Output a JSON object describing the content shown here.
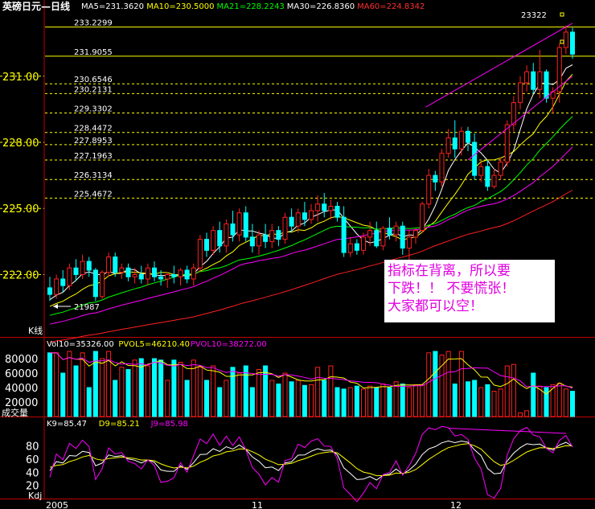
{
  "title": "英磅日元—日线",
  "ma_legend": [
    {
      "label": "MA5=231.3620",
      "color": "#ffffff"
    },
    {
      "label": "MA10=230.5000",
      "color": "#ffff00"
    },
    {
      "label": "MA21=228.2243",
      "color": "#00ff00"
    },
    {
      "label": "MA30=226.8360",
      "color": "#ffffff"
    },
    {
      "label": "MA60=224.8342",
      "color": "#ff3030"
    }
  ],
  "price_axis_ticks": [
    "231.00",
    "228.00",
    "225.00",
    "222.00"
  ],
  "fib_levels": [
    "233.2299",
    "231.9055",
    "230.6546",
    "230.2131",
    "229.3302",
    "228.4472",
    "227.8953",
    "227.1963",
    "226.3134",
    "225.4672"
  ],
  "high_label": "23322",
  "low_label": "21987",
  "kline_label": "K线",
  "annotation": [
    "指标在背离，所以要",
    "下跌！！ 不要慌张！",
    "大家都可以空！"
  ],
  "volume": {
    "legend": [
      {
        "label": "Vol10=35326.00",
        "color": "#ffffff"
      },
      {
        "label": "PVOL5=46210.40",
        "color": "#ffff00"
      },
      {
        "label": "PVOL10=38272.00",
        "color": "#ff00ff"
      }
    ],
    "axis_ticks": [
      "80000",
      "60000",
      "40000",
      "20000"
    ],
    "panel_label": "成交量"
  },
  "kdj": {
    "legend": [
      {
        "label": "K9=85.47",
        "color": "#ffffff"
      },
      {
        "label": "D9=85.21",
        "color": "#ffff00"
      },
      {
        "label": "J9=85.98",
        "color": "#ff00ff"
      }
    ],
    "axis_ticks": [
      "80",
      "60",
      "40",
      "20"
    ],
    "panel_label": "Kdj"
  },
  "date_axis": [
    "2005",
    "11",
    "12"
  ],
  "chart_data": {
    "type": "candlestick",
    "title": "英磅日元—日线",
    "price_range": [
      219.5,
      233.8
    ],
    "candles_ohlc": [
      [
        221.4,
        221.9,
        220.8,
        221.1
      ],
      [
        221.1,
        222.0,
        220.9,
        221.8
      ],
      [
        221.8,
        222.2,
        221.2,
        221.5
      ],
      [
        221.5,
        222.5,
        221.3,
        222.3
      ],
      [
        222.3,
        222.7,
        221.7,
        222.0
      ],
      [
        222.0,
        222.9,
        221.8,
        222.6
      ],
      [
        222.6,
        222.8,
        221.9,
        222.2
      ],
      [
        222.2,
        222.3,
        220.8,
        221.0
      ],
      [
        221.0,
        222.2,
        220.9,
        222.1
      ],
      [
        222.1,
        223.0,
        221.9,
        222.8
      ],
      [
        222.8,
        223.0,
        221.9,
        222.1
      ],
      [
        222.1,
        222.5,
        221.8,
        222.3
      ],
      [
        222.3,
        222.5,
        221.7,
        221.9
      ],
      [
        221.9,
        222.3,
        221.6,
        222.0
      ],
      [
        222.0,
        222.4,
        221.6,
        221.8
      ],
      [
        221.8,
        222.5,
        221.5,
        222.3
      ],
      [
        222.3,
        222.6,
        221.7,
        221.9
      ],
      [
        221.9,
        222.2,
        221.5,
        221.8
      ],
      [
        221.8,
        222.1,
        221.4,
        222.0
      ],
      [
        222.0,
        222.4,
        221.6,
        221.9
      ],
      [
        221.9,
        222.3,
        221.5,
        222.2
      ],
      [
        222.2,
        222.4,
        221.6,
        221.8
      ],
      [
        221.8,
        222.5,
        221.5,
        222.3
      ],
      [
        222.3,
        223.8,
        222.1,
        223.6
      ],
      [
        223.6,
        223.9,
        222.8,
        223.1
      ],
      [
        223.1,
        224.2,
        222.9,
        224.0
      ],
      [
        224.0,
        224.4,
        223.0,
        223.3
      ],
      [
        223.3,
        224.5,
        223.0,
        224.3
      ],
      [
        224.3,
        224.9,
        223.5,
        223.8
      ],
      [
        223.8,
        225.0,
        223.5,
        224.8
      ],
      [
        224.8,
        225.1,
        223.5,
        223.7
      ],
      [
        223.7,
        224.3,
        223.0,
        223.3
      ],
      [
        223.3,
        224.0,
        222.9,
        223.8
      ],
      [
        223.8,
        224.3,
        223.2,
        223.5
      ],
      [
        223.5,
        224.3,
        223.2,
        224.0
      ],
      [
        224.0,
        224.2,
        223.3,
        223.6
      ],
      [
        223.6,
        224.8,
        223.4,
        224.6
      ],
      [
        224.6,
        225.0,
        223.9,
        224.2
      ],
      [
        224.2,
        225.0,
        223.9,
        224.8
      ],
      [
        224.8,
        225.3,
        224.2,
        224.5
      ],
      [
        224.5,
        225.2,
        224.3,
        224.9
      ],
      [
        224.9,
        225.6,
        224.4,
        225.2
      ],
      [
        225.2,
        225.7,
        224.6,
        224.9
      ],
      [
        224.9,
        225.4,
        224.5,
        225.1
      ],
      [
        225.1,
        225.3,
        224.4,
        224.6
      ],
      [
        224.6,
        225.1,
        222.8,
        223.0
      ],
      [
        223.0,
        223.7,
        222.8,
        223.4
      ],
      [
        223.4,
        223.6,
        222.9,
        223.1
      ],
      [
        223.1,
        223.9,
        222.9,
        223.7
      ],
      [
        223.7,
        224.4,
        223.3,
        224.0
      ],
      [
        224.0,
        224.4,
        223.2,
        223.3
      ],
      [
        223.3,
        224.2,
        223.1,
        224.1
      ],
      [
        224.1,
        224.6,
        223.6,
        223.8
      ],
      [
        223.8,
        224.4,
        223.5,
        224.2
      ],
      [
        224.2,
        224.4,
        222.9,
        223.2
      ],
      [
        223.2,
        224.0,
        222.6,
        223.7
      ],
      [
        223.7,
        224.1,
        223.4,
        224.0
      ],
      [
        224.0,
        225.3,
        223.9,
        225.2
      ],
      [
        225.2,
        226.8,
        225.0,
        226.5
      ],
      [
        226.5,
        226.7,
        225.8,
        226.2
      ],
      [
        226.2,
        227.7,
        226.0,
        227.5
      ],
      [
        227.5,
        228.6,
        227.3,
        228.2
      ],
      [
        228.2,
        229.0,
        227.3,
        227.7
      ],
      [
        227.7,
        228.7,
        227.4,
        228.5
      ],
      [
        228.5,
        228.7,
        227.6,
        228.0
      ],
      [
        228.0,
        228.4,
        226.3,
        226.5
      ],
      [
        226.5,
        227.1,
        226.2,
        226.9
      ],
      [
        226.9,
        227.2,
        225.8,
        226.0
      ],
      [
        226.0,
        226.8,
        225.9,
        226.5
      ],
      [
        226.5,
        227.3,
        226.3,
        227.1
      ],
      [
        227.1,
        229.0,
        226.9,
        228.8
      ],
      [
        228.8,
        230.1,
        228.5,
        229.8
      ],
      [
        229.8,
        231.0,
        229.5,
        230.7
      ],
      [
        230.7,
        231.5,
        230.3,
        231.2
      ],
      [
        231.2,
        231.6,
        230.2,
        230.4
      ],
      [
        230.4,
        232.2,
        230.0,
        231.2
      ],
      [
        231.2,
        231.3,
        229.8,
        230.0
      ],
      [
        230.0,
        230.5,
        229.3,
        230.3
      ],
      [
        230.3,
        232.5,
        229.8,
        232.3
      ],
      [
        232.3,
        233.3,
        232.0,
        233.0
      ],
      [
        233.0,
        233.2,
        231.8,
        232.0
      ]
    ],
    "ma_series": [
      {
        "name": "MA5",
        "last": 231.362
      },
      {
        "name": "MA10",
        "last": 230.5
      },
      {
        "name": "MA21",
        "last": 228.2243
      },
      {
        "name": "MA30",
        "last": 226.836
      },
      {
        "name": "MA60",
        "last": 224.8342
      }
    ],
    "volume_range": [
      0,
      100000
    ],
    "volumes": [
      88000,
      88000,
      60000,
      90000,
      70000,
      88000,
      40000,
      90000,
      80000,
      90000,
      50000,
      68000,
      65000,
      78000,
      80000,
      70000,
      80000,
      78000,
      50000,
      78000,
      75000,
      50000,
      78000,
      68000,
      50000,
      70000,
      40000,
      50000,
      68000,
      60000,
      70000,
      40000,
      65000,
      70000,
      50000,
      45000,
      60000,
      48000,
      50000,
      43000,
      44000,
      68000,
      50000,
      70000,
      40000,
      38000,
      40000,
      42000,
      38000,
      42000,
      40000,
      45000,
      40000,
      48000,
      45000,
      40000,
      44000,
      44000,
      88000,
      90000,
      85000,
      90000,
      45000,
      90000,
      48000,
      50000,
      40000,
      44000,
      35000,
      38000,
      70000,
      72000,
      5000,
      8000,
      60000,
      42000,
      40000,
      44000,
      46000,
      38000,
      35000
    ],
    "kdj_range": [
      0,
      110
    ]
  }
}
